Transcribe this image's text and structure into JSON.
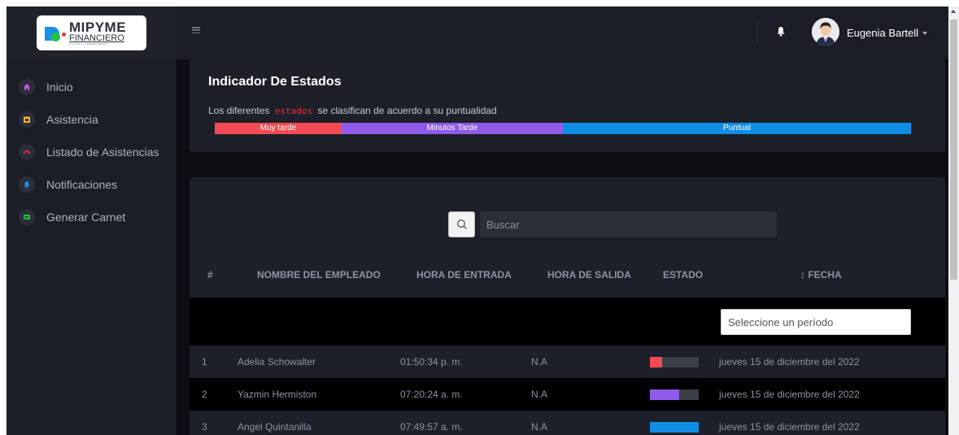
{
  "brand": {
    "logo_line1": "MIPYME",
    "logo_line2": "FINANCIERO",
    "logo_tagline": "S.A.S. P.A.C. / CREDITO DIRECTO",
    "colors": {
      "blue": "#1b8fe6",
      "green": "#24c23a",
      "red": "#e8323d"
    }
  },
  "sidebar": {
    "items": [
      {
        "label": "Inicio",
        "icon": "home-icon",
        "color": "#c552e8"
      },
      {
        "label": "Asistencia",
        "icon": "calendar-icon",
        "color": "#f7b531"
      },
      {
        "label": "Listado de Asistencias",
        "icon": "gauge-icon",
        "color": "#e8323d"
      },
      {
        "label": "Notificaciones",
        "icon": "bell-icon",
        "color": "#1b8fe6"
      },
      {
        "label": "Generar Carnet",
        "icon": "id-card-icon",
        "color": "#24c23a"
      }
    ]
  },
  "header": {
    "menu_icon": "hamburger-icon",
    "notification_icon": "bell-icon",
    "user_name": "Eugenia Bartell"
  },
  "indicator": {
    "title": "Indicador De Estados",
    "desc_before": "Los diferentes",
    "desc_code": "estados",
    "desc_after": "se clasifican de acuerdo a su puntualidad",
    "bars": [
      {
        "label": "Muy tarde",
        "color": "#f24b55",
        "share": 0.182
      },
      {
        "label": "Minutos Tarde",
        "color": "#8f5be8",
        "share": 0.318
      },
      {
        "label": "Puntual",
        "color": "#0f8ee6",
        "share": 0.5
      }
    ]
  },
  "search": {
    "placeholder": "Buscar",
    "icon": "search-icon"
  },
  "table": {
    "headers": [
      "#",
      "NOMBRE DEL EMPLEADO",
      "HORA DE ENTRADA",
      "HORA DE SALIDA",
      "ESTADO",
      "↕ FECHA"
    ],
    "period_placeholder": "Seleccione un período",
    "rows": [
      {
        "num": "1",
        "name": "Adelia Schowalter",
        "entry": "01:50:34 p. m.",
        "exit": "N.A",
        "status_color": "#f24b55",
        "status_level": 0.25,
        "date": "jueves 15 de diciembre del 2022"
      },
      {
        "num": "2",
        "name": "Yazmin Hermiston",
        "entry": "07:20:24 a. m.",
        "exit": "N.A",
        "status_color": "#8f5be8",
        "status_level": 0.6,
        "date": "jueves 15 de diciembre del 2022"
      },
      {
        "num": "3",
        "name": "Angel Quintanilla",
        "entry": "07:49:57 a. m.",
        "exit": "N.A",
        "status_color": "#0f8ee6",
        "status_level": 1.0,
        "date": "jueves 15 de diciembre del 2022"
      }
    ]
  }
}
